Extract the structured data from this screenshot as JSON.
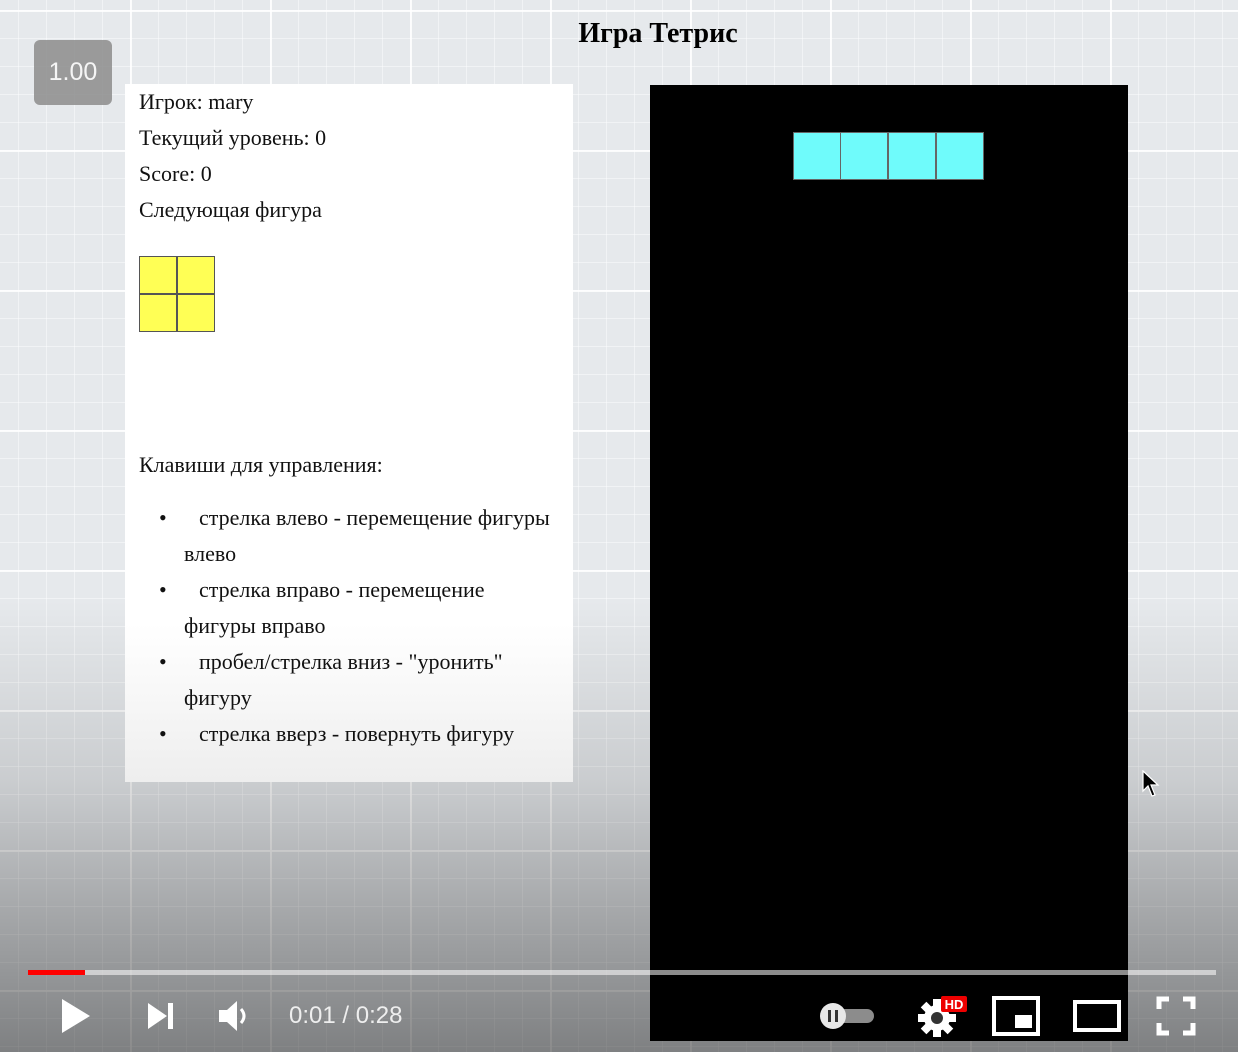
{
  "page": {
    "title": "Игра Тетрис"
  },
  "player": {
    "speed_badge": "1.00"
  },
  "info": {
    "player_line": "Игрок: mary",
    "level_line": "Текущий уровень: 0",
    "score_line": "Score: 0",
    "next_label": "Следующая фигура",
    "next_piece": {
      "shape": "O",
      "color": "#ffff55"
    }
  },
  "controls_help": {
    "title": "Клавиши для управления:",
    "items": [
      "стрелка влево - перемещение фигуры влево",
      "стрелка вправо - перемещение фигуры вправо",
      "пробел/стрелка вниз - \"уронить\" фигуру",
      "стрелка вверз - повернуть фигуру"
    ]
  },
  "board": {
    "background": "#000000",
    "current_piece": {
      "shape": "I",
      "color": "#6ffbfb"
    }
  },
  "video": {
    "time_current": "0:01",
    "time_total": "0:28",
    "time_text": "0:01 / 0:28",
    "progress_fraction": 0.048,
    "progress_color": "#ff0000",
    "icons": [
      "play-icon",
      "next-icon",
      "volume-icon",
      "autoplay-toggle-icon",
      "settings-icon",
      "miniplayer-icon",
      "theater-mode-icon",
      "fullscreen-icon"
    ],
    "hd_badge": "HD"
  }
}
